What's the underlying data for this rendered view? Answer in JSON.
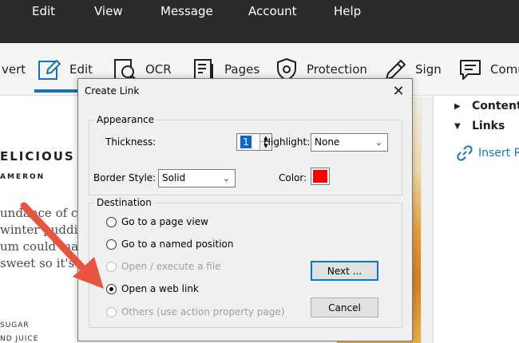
{
  "menubar": {
    "items": [
      "Edit",
      "View",
      "Message",
      "Account",
      "Help"
    ]
  },
  "toolbar": {
    "items": [
      {
        "label": "vert",
        "icon": "convert-icon"
      },
      {
        "label": "Edit",
        "icon": "edit-pencil-icon"
      },
      {
        "label": "OCR",
        "icon": "ocr-icon"
      },
      {
        "label": "Pages",
        "icon": "pages-icon"
      },
      {
        "label": "Protection",
        "icon": "shield-icon"
      },
      {
        "label": "Sign",
        "icon": "pen-icon"
      },
      {
        "label": "Comm",
        "icon": "comment-icon"
      }
    ],
    "active": "Edit",
    "accent": "#1473b8"
  },
  "document": {
    "heading": "ELICIOUS /",
    "byline": "AMERON",
    "paragraph": [
      "undance of ci",
      "winter pudding",
      "um could mak",
      "sweet so it's a"
    ],
    "ingredients": [
      "SUGAR",
      "ND JUICE"
    ]
  },
  "right_panel": {
    "items": [
      {
        "label": "Content",
        "expanded": false
      },
      {
        "label": "Links",
        "expanded": true
      }
    ],
    "insert_label": "Insert Re",
    "insert_icon": "link-icon",
    "link_color": "#1b73c8"
  },
  "dialog": {
    "title": "Create Link",
    "close_glyph": "✕",
    "appearance": {
      "label": "Appearance",
      "thickness_label": "Thickness:",
      "thickness_value": "1",
      "highlight_label": "Highlight:",
      "highlight_value": "None",
      "border_style_label": "Border Style:",
      "border_style_value": "Solid",
      "color_label": "Color:",
      "color_value": "#ff0000"
    },
    "destination": {
      "label": "Destination",
      "options": [
        {
          "label": "Go to a page view",
          "checked": false,
          "enabled": true
        },
        {
          "label": "Go to a named position",
          "checked": false,
          "enabled": true
        },
        {
          "label": "Open / execute a file",
          "checked": false,
          "enabled": false
        },
        {
          "label": "Open a web link",
          "checked": true,
          "enabled": true
        },
        {
          "label": "Others (use action property page)",
          "checked": false,
          "enabled": false
        }
      ]
    },
    "next_button": "Next ...",
    "cancel_button": "Cancel"
  },
  "arrow": {
    "color": "#e8553e"
  }
}
